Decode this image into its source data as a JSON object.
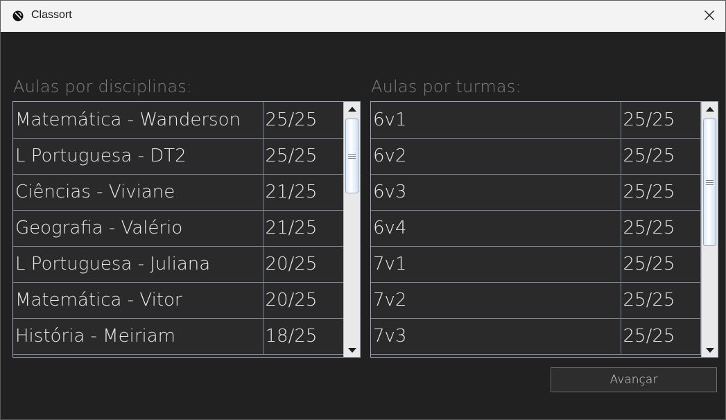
{
  "window": {
    "title": "Classort",
    "app_icon": "classort-logo-icon",
    "close_icon": "close-icon"
  },
  "disciplines": {
    "label": "Aulas por disciplinas:",
    "rows": [
      {
        "name": "Matemática - Wanderson",
        "count": "25/25"
      },
      {
        "name": "L Portuguesa - DT2",
        "count": "25/25"
      },
      {
        "name": "Ciências - Viviane",
        "count": "21/25"
      },
      {
        "name": "Geografia - Valério",
        "count": "21/25"
      },
      {
        "name": "L Portuguesa - Juliana",
        "count": "20/25"
      },
      {
        "name": "Matemática - Vitor",
        "count": "20/25"
      },
      {
        "name": "História - Meiriam",
        "count": "18/25"
      }
    ],
    "scroll_position": 0.0
  },
  "classes": {
    "label": "Aulas por turmas:",
    "rows": [
      {
        "name": "6v1",
        "count": "25/25"
      },
      {
        "name": "6v2",
        "count": "25/25"
      },
      {
        "name": "6v3",
        "count": "25/25"
      },
      {
        "name": "6v4",
        "count": "25/25"
      },
      {
        "name": "7v1",
        "count": "25/25"
      },
      {
        "name": "7v2",
        "count": "25/25"
      },
      {
        "name": "7v3",
        "count": "25/25"
      }
    ],
    "scroll_position": 0.0
  },
  "actions": {
    "advance_label": "Avançar"
  },
  "colors": {
    "background": "#212121",
    "titlebar": "#f3f3f3",
    "cell_border": "#7d8896",
    "label_text": "#7e7e7e"
  }
}
